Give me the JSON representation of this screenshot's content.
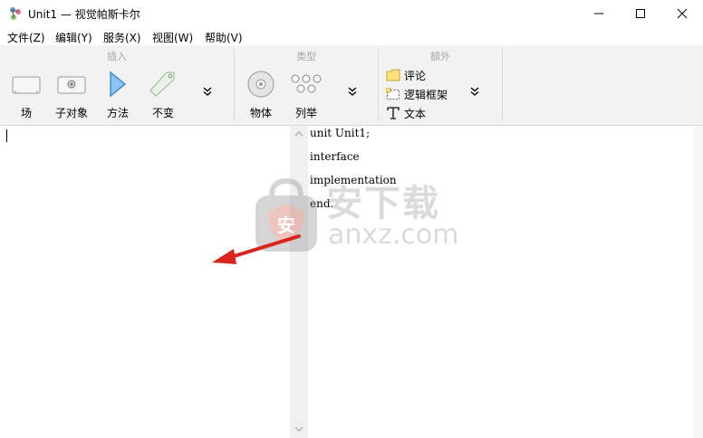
{
  "window": {
    "title": "Unit1 — 视觉帕斯卡尔"
  },
  "menu": [
    "文件(Z)",
    "编辑(Y)",
    "服务(X)",
    "视图(W)",
    "帮助(V)"
  ],
  "ribbon": {
    "groups": {
      "insert": {
        "title": "插入",
        "buttons": [
          "场",
          "子对象",
          "方法",
          "不变"
        ]
      },
      "type": {
        "title": "类型",
        "buttons": [
          "物体",
          "列举"
        ]
      },
      "extra": {
        "title": "额外",
        "buttons": [
          "评论",
          "逻辑框架",
          "文本"
        ]
      }
    }
  },
  "code": [
    "unit Unit1;",
    "interface",
    "implementation",
    "end."
  ],
  "watermark": {
    "cn": "安下载",
    "en": "anxz.com",
    "badge": "安"
  },
  "colors": {
    "arrow": "#d9261c",
    "accent_blue": "#3d8fd6",
    "ribbon_bg": "#f2f2f2"
  }
}
